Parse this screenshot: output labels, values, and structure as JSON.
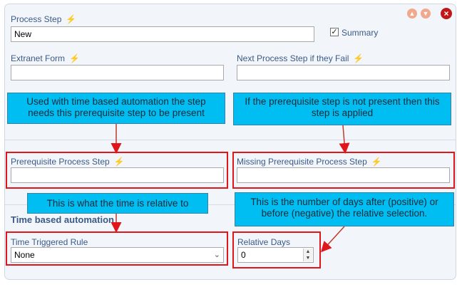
{
  "form": {
    "process_step": {
      "label": "Process Step",
      "value": "New"
    },
    "summary_label": "Summary",
    "summary_checked": true,
    "extranet_form": {
      "label": "Extranet Form",
      "value": ""
    },
    "next_step_fail": {
      "label": "Next Process Step if they Fail",
      "value": ""
    },
    "prereq_step": {
      "label": "Prerequisite Process Step",
      "value": ""
    },
    "missing_prereq_step": {
      "label": "Missing Prerequisite Process Step",
      "value": ""
    },
    "section_title": "Time based automation",
    "time_triggered_rule": {
      "label": "Time Triggered Rule",
      "selected": "None"
    },
    "relative_days": {
      "label": "Relative Days",
      "value": "0"
    }
  },
  "callouts": {
    "prereq_note": "Used with time based automation the step needs this prerequisite step to be present",
    "missing_note": "If the prerequisite step is not present then this step is applied",
    "time_note": "This is what the time is relative to",
    "days_note": "This is the number of days after (positive) or before (negative) the relative selection."
  },
  "icons": {
    "lightning": "lightning-icon",
    "move_up": "arrow-up-icon",
    "move_down": "arrow-down-icon",
    "close": "close-icon"
  },
  "colors": {
    "callout": "#00bef2",
    "highlight": "#e0161b",
    "label": "#3b5a86"
  }
}
